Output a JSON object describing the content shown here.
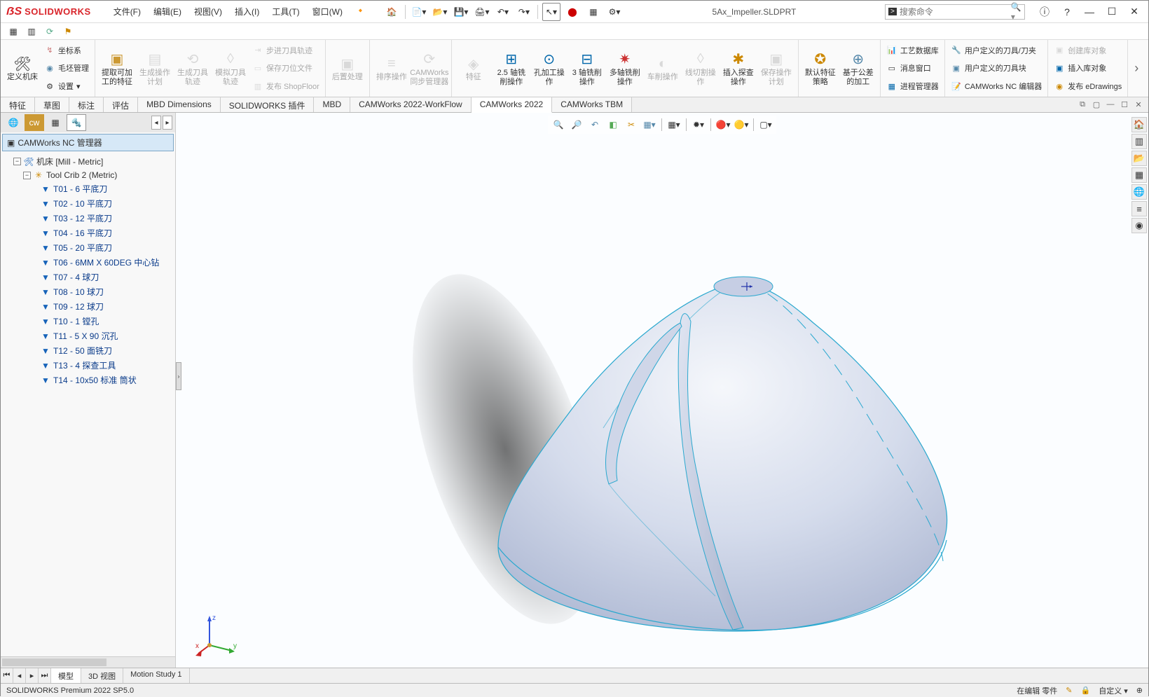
{
  "app": {
    "name": "SOLIDWORKS",
    "doc": "5Ax_Impeller.SLDPRT"
  },
  "menu": [
    "文件(F)",
    "编辑(E)",
    "视图(V)",
    "插入(I)",
    "工具(T)",
    "窗口(W)"
  ],
  "search": {
    "placeholder": "搜索命令"
  },
  "ribbon": {
    "btn_define": "定义机床",
    "btn_coord": "坐标系",
    "btn_stock": "毛坯管理",
    "btn_setup": "设置",
    "btn_extract": "提取可加工的特征",
    "btn_genplan": "生成操作计划",
    "btn_gentool": "生成刀具轨迹",
    "btn_simtool": "模拟刀具轨迹",
    "btn_step": "步进刀具轨迹",
    "btn_savecl": "保存刀位文件",
    "btn_shop": "发布 ShopFloor",
    "btn_post": "后置处理",
    "btn_sort": "排序操作",
    "btn_sync": "CAMWorks 同步管理器",
    "btn_feature": "特征",
    "btn_25ax": "2.5 轴铣削操作",
    "btn_holeop": "孔加工操作",
    "btn_3ax": "3 轴铣削操作",
    "btn_multi": "多轴铣削操作",
    "btn_turn": "车削操作",
    "btn_wire": "线切割操作",
    "btn_probe": "插入探查操作",
    "btn_saveplan": "保存操作计划",
    "btn_default": "默认特征策略",
    "btn_tol": "基于公差的加工",
    "btn_techdb": "工艺数据库",
    "btn_msg": "消息窗口",
    "btn_procmgr": "进程管理器",
    "btn_usertool": "用户定义的刀具/刀夹",
    "btn_userblk": "用户定义的刀具块",
    "btn_nced": "CAMWorks NC 编辑器",
    "btn_newlib": "创建库对象",
    "btn_inslib": "插入库对象",
    "btn_edraw": "发布 eDrawings"
  },
  "tabs": [
    "特征",
    "草图",
    "标注",
    "评估",
    "MBD Dimensions",
    "SOLIDWORKS 插件",
    "MBD",
    "CAMWorks 2022-WorkFlow",
    "CAMWorks 2022",
    "CAMWorks TBM"
  ],
  "active_tab": "CAMWorks 2022",
  "tree": {
    "header": "CAMWorks NC 管理器",
    "machine": "机床 [Mill - Metric]",
    "crib": "Tool Crib 2 (Metric)",
    "tools": [
      "T01 - 6 平底刀",
      "T02 - 10 平底刀",
      "T03 - 12 平底刀",
      "T04 - 16 平底刀",
      "T05 - 20 平底刀",
      "T06 - 6MM X 60DEG 中心钻",
      "T07 - 4 球刀",
      "T08 - 10 球刀",
      "T09 - 12 球刀",
      "T10 - 1 镗孔",
      "T11 - 5 X 90 沉孔",
      "T12 - 50 面铣刀",
      "T13 - 4 探查工具",
      "T14 - 10x50 标准 筒状"
    ]
  },
  "bottom_tabs": [
    "模型",
    "3D 视图",
    "Motion Study 1"
  ],
  "status": {
    "left": "SOLIDWORKS Premium 2022 SP5.0",
    "edit": "在编辑 零件",
    "custom": "自定义"
  }
}
